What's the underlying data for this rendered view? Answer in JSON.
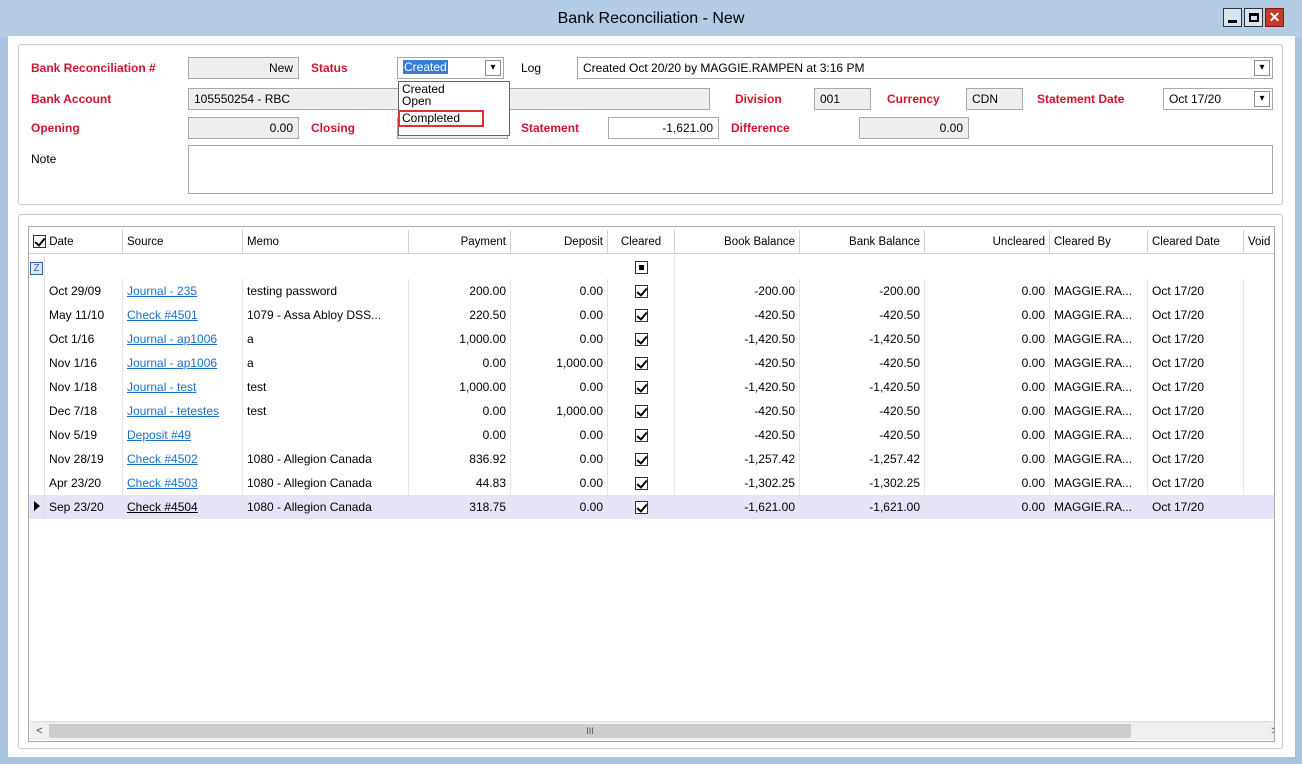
{
  "window": {
    "title": "Bank Reconciliation - New"
  },
  "header": {
    "recon_label": "Bank Reconciliation #",
    "recon_value": "New",
    "status_label": "Status",
    "status_value": "Created",
    "status_options": [
      "Created",
      "Open",
      "Completed"
    ],
    "log_label": "Log",
    "log_value": "Created Oct 20/20 by MAGGIE.RAMPEN at 3:16 PM",
    "bank_account_label": "Bank Account",
    "bank_account_value": "105550254 - RBC",
    "division_label": "Division",
    "division_value": "001",
    "currency_label": "Currency",
    "currency_value": "CDN",
    "statement_date_label": "Statement Date",
    "statement_date_value": "Oct 17/20",
    "opening_label": "Opening",
    "opening_value": "0.00",
    "closing_label": "Closing",
    "statement_label": "Statement",
    "statement_value": "-1,621.00",
    "difference_label": "Difference",
    "difference_value": "0.00",
    "note_label": "Note"
  },
  "grid": {
    "columns": [
      "Date",
      "Source",
      "Memo",
      "Payment",
      "Deposit",
      "Cleared",
      "Book Balance",
      "Bank Balance",
      "Uncleared",
      "Cleared By",
      "Cleared Date",
      "Void"
    ],
    "rows": [
      {
        "date": "Oct 29/09",
        "source": "Journal - 235",
        "memo": "testing password",
        "payment": "200.00",
        "deposit": "0.00",
        "book": "-200.00",
        "bank": "-200.00",
        "uncleared": "0.00",
        "cleared_by": "MAGGIE.RA...",
        "cleared_date": "Oct 17/20"
      },
      {
        "date": "May 11/10",
        "source": "Check #4501",
        "memo": "1079 - Assa Abloy DSS...",
        "payment": "220.50",
        "deposit": "0.00",
        "book": "-420.50",
        "bank": "-420.50",
        "uncleared": "0.00",
        "cleared_by": "MAGGIE.RA...",
        "cleared_date": "Oct 17/20"
      },
      {
        "date": "Oct 1/16",
        "source": "Journal - ap1006",
        "memo": "a",
        "payment": "1,000.00",
        "deposit": "0.00",
        "book": "-1,420.50",
        "bank": "-1,420.50",
        "uncleared": "0.00",
        "cleared_by": "MAGGIE.RA...",
        "cleared_date": "Oct 17/20"
      },
      {
        "date": "Nov 1/16",
        "source": "Journal - ap1006",
        "memo": "a",
        "payment": "0.00",
        "deposit": "1,000.00",
        "book": "-420.50",
        "bank": "-420.50",
        "uncleared": "0.00",
        "cleared_by": "MAGGIE.RA...",
        "cleared_date": "Oct 17/20"
      },
      {
        "date": "Nov 1/18",
        "source": "Journal - test",
        "memo": "test",
        "payment": "1,000.00",
        "deposit": "0.00",
        "book": "-1,420.50",
        "bank": "-1,420.50",
        "uncleared": "0.00",
        "cleared_by": "MAGGIE.RA...",
        "cleared_date": "Oct 17/20"
      },
      {
        "date": "Dec 7/18",
        "source": "Journal - tetestes",
        "memo": "test",
        "payment": "0.00",
        "deposit": "1,000.00",
        "book": "-420.50",
        "bank": "-420.50",
        "uncleared": "0.00",
        "cleared_by": "MAGGIE.RA...",
        "cleared_date": "Oct 17/20"
      },
      {
        "date": "Nov 5/19",
        "source": "Deposit #49",
        "memo": "",
        "payment": "0.00",
        "deposit": "0.00",
        "book": "-420.50",
        "bank": "-420.50",
        "uncleared": "0.00",
        "cleared_by": "MAGGIE.RA...",
        "cleared_date": "Oct 17/20"
      },
      {
        "date": "Nov 28/19",
        "source": "Check #4502",
        "memo": "1080 - Allegion Canada",
        "payment": "836.92",
        "deposit": "0.00",
        "book": "-1,257.42",
        "bank": "-1,257.42",
        "uncleared": "0.00",
        "cleared_by": "MAGGIE.RA...",
        "cleared_date": "Oct 17/20"
      },
      {
        "date": "Apr 23/20",
        "source": "Check #4503",
        "memo": "1080 - Allegion Canada",
        "payment": "44.83",
        "deposit": "0.00",
        "book": "-1,302.25",
        "bank": "-1,302.25",
        "uncleared": "0.00",
        "cleared_by": "MAGGIE.RA...",
        "cleared_date": "Oct 17/20"
      },
      {
        "date": "Sep 23/20",
        "source": "Check #4504",
        "memo": "1080 - Allegion Canada",
        "payment": "318.75",
        "deposit": "0.00",
        "book": "-1,621.00",
        "bank": "-1,621.00",
        "uncleared": "0.00",
        "cleared_by": "MAGGIE.RA...",
        "cleared_date": "Oct 17/20"
      }
    ],
    "scroll_thumb_glyph": "III"
  },
  "colors": {
    "label_red": "#d2142f",
    "link_blue": "#1a6fd1",
    "selected_row": "#e5e5f7"
  }
}
